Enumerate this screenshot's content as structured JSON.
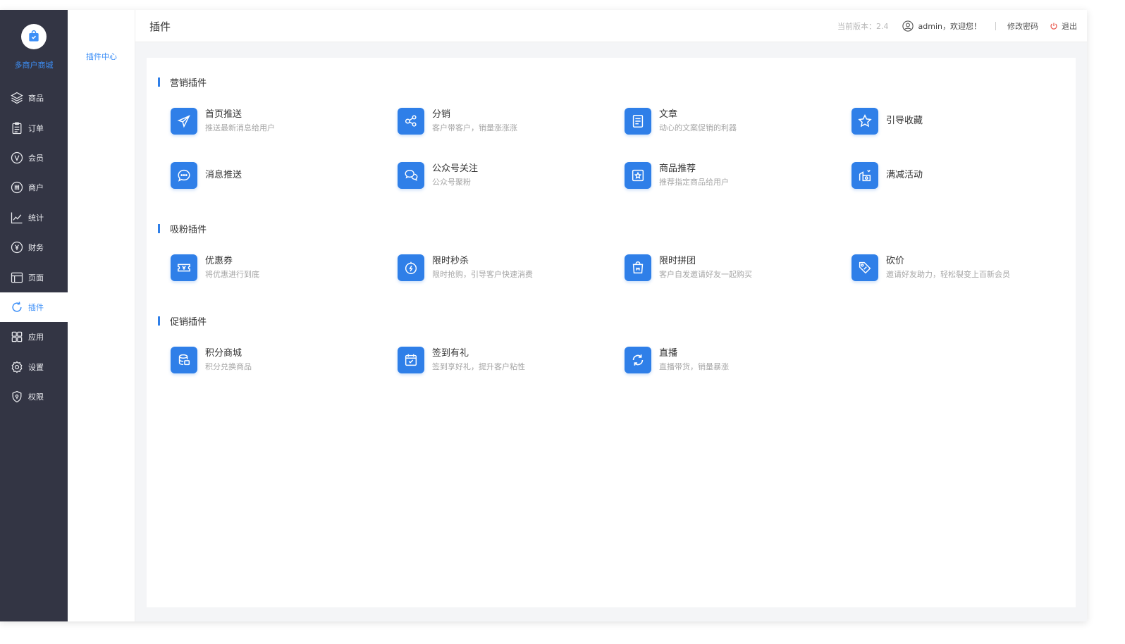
{
  "brand": {
    "name": "多商户商城"
  },
  "sidebar": {
    "items": [
      {
        "label": "商品",
        "icon": "layers-icon"
      },
      {
        "label": "订单",
        "icon": "clipboard-icon"
      },
      {
        "label": "会员",
        "icon": "vip-icon"
      },
      {
        "label": "商户",
        "icon": "merchant-icon"
      },
      {
        "label": "统计",
        "icon": "chart-icon"
      },
      {
        "label": "财务",
        "icon": "finance-icon"
      },
      {
        "label": "页面",
        "icon": "page-icon"
      },
      {
        "label": "插件",
        "icon": "plugin-icon",
        "active": true
      },
      {
        "label": "应用",
        "icon": "apps-icon"
      },
      {
        "label": "设置",
        "icon": "gear-icon"
      },
      {
        "label": "权限",
        "icon": "shield-icon"
      }
    ]
  },
  "subnav": {
    "items": [
      {
        "label": "插件中心"
      }
    ]
  },
  "header": {
    "title": "插件",
    "version": "当前版本：2.4",
    "user": "admin，欢迎您！",
    "change_password": "修改密码",
    "logout": "退出"
  },
  "sections": [
    {
      "title": "营销插件",
      "plugins": [
        {
          "name": "首页推送",
          "desc": "推送最新消息给用户",
          "icon": "send-icon"
        },
        {
          "name": "分销",
          "desc": "客户带客户，销量涨涨涨",
          "icon": "share-icon"
        },
        {
          "name": "文章",
          "desc": "动心的文案促销的利器",
          "icon": "article-icon"
        },
        {
          "name": "引导收藏",
          "desc": "",
          "icon": "star-icon"
        },
        {
          "name": "消息推送",
          "desc": "",
          "icon": "chat-icon"
        },
        {
          "name": "公众号关注",
          "desc": "公众号聚粉",
          "icon": "wechat-icon"
        },
        {
          "name": "商品推荐",
          "desc": "推荐指定商品给用户",
          "icon": "recommend-icon"
        },
        {
          "name": "满减活动",
          "desc": "",
          "icon": "discount-icon"
        }
      ]
    },
    {
      "title": "吸粉插件",
      "plugins": [
        {
          "name": "优惠券",
          "desc": "将优惠进行到底",
          "icon": "coupon-icon"
        },
        {
          "name": "限时秒杀",
          "desc": "限时抢购，引导客户快速消费",
          "icon": "timer-icon"
        },
        {
          "name": "限时拼团",
          "desc": "客户自发邀请好友一起购买",
          "icon": "group-buy-icon"
        },
        {
          "name": "砍价",
          "desc": "邀请好友助力，轻松裂变上百新会员",
          "icon": "price-tag-icon"
        }
      ]
    },
    {
      "title": "促销插件",
      "plugins": [
        {
          "name": "积分商城",
          "desc": "积分兑换商品",
          "icon": "points-icon"
        },
        {
          "name": "签到有礼",
          "desc": "签到享好礼，提升客户粘性",
          "icon": "checkin-icon"
        },
        {
          "name": "直播",
          "desc": "直播带货，销量暴涨",
          "icon": "live-icon"
        }
      ]
    }
  ],
  "colors": {
    "sidebar_bg": "#333544",
    "accent": "#2f7fe8",
    "brand_text": "#3d8ff7"
  }
}
